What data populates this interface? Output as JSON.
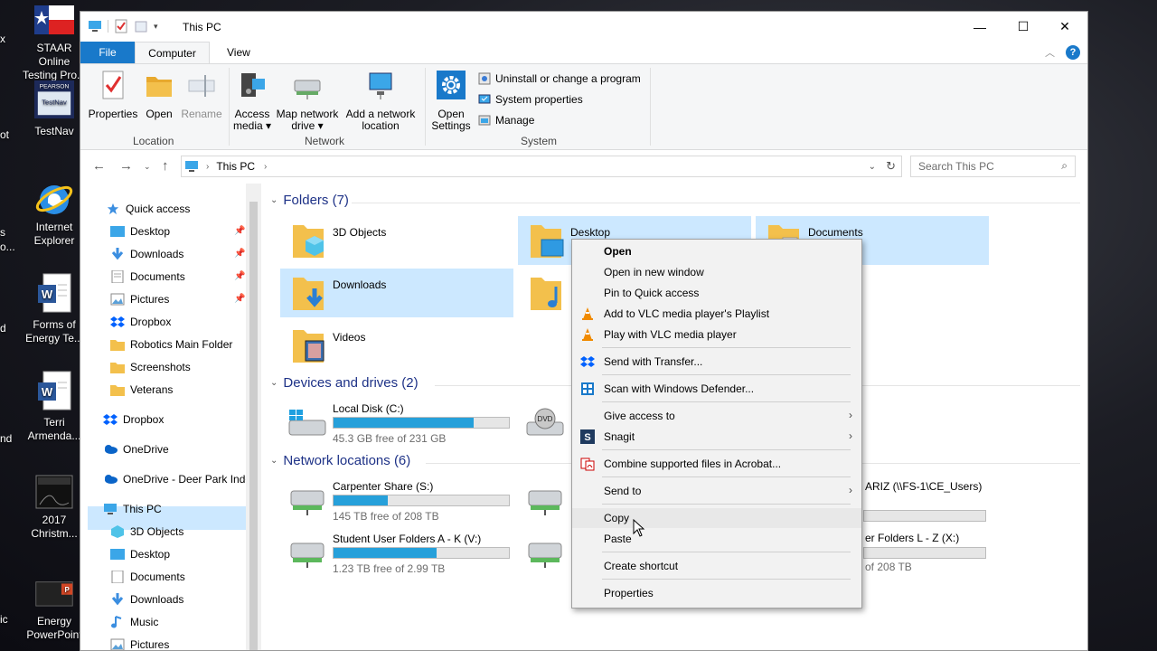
{
  "desktop": {
    "icons": [
      {
        "label": "STAAR Online Testing Pro...",
        "name": "staar-online-icon"
      },
      {
        "label": "TestNav",
        "name": "testnav-icon"
      },
      {
        "label": "Internet Explorer",
        "name": "internet-explorer-icon"
      },
      {
        "label": "Forms of Energy Te...",
        "name": "word-doc-icon"
      },
      {
        "label": "Terri Armenda...",
        "name": "word-doc-icon"
      },
      {
        "label": "2017 Christm...",
        "name": "video-thumbnail-icon"
      },
      {
        "label": "Energy PowerPoint",
        "name": "powerpoint-icon"
      }
    ],
    "edge_labels": [
      "x",
      "ot",
      "s",
      "o...",
      "d",
      "nd",
      "ic"
    ],
    "testnav_badge": "PEARSON",
    "testnav_badge_label": "TestNav"
  },
  "window": {
    "title": "This PC",
    "controls": {
      "minimize": "—",
      "maximize": "☐",
      "close": "✕"
    }
  },
  "ribbon": {
    "tabs": {
      "file": "File",
      "computer": "Computer",
      "view": "View"
    },
    "location": {
      "label": "Location",
      "properties": "Properties",
      "open": "Open",
      "rename": "Rename"
    },
    "network": {
      "label": "Network",
      "access_media_l1": "Access",
      "access_media_l2": "media ▾",
      "map_drive_l1": "Map network",
      "map_drive_l2": "drive ▾",
      "add_location_l1": "Add a network",
      "add_location_l2": "location"
    },
    "system": {
      "label": "System",
      "open_settings_l1": "Open",
      "open_settings_l2": "Settings",
      "uninstall": "Uninstall or change a program",
      "system_properties": "System properties",
      "manage": "Manage"
    }
  },
  "address": {
    "path": "This PC",
    "search_placeholder": "Search This PC"
  },
  "nav": {
    "quick_access": "Quick access",
    "items": [
      {
        "label": "Desktop",
        "pinned": true
      },
      {
        "label": "Downloads",
        "pinned": true
      },
      {
        "label": "Documents",
        "pinned": true
      },
      {
        "label": "Pictures",
        "pinned": true
      },
      {
        "label": "Dropbox"
      },
      {
        "label": "Robotics Main Folder"
      },
      {
        "label": "Screenshots"
      },
      {
        "label": "Veterans"
      }
    ],
    "dropbox": "Dropbox",
    "onedrive": "OneDrive",
    "onedrive_org": "OneDrive - Deer Park Inde",
    "this_pc": "This PC",
    "pc_items": [
      "3D Objects",
      "Desktop",
      "Documents",
      "Downloads",
      "Music",
      "Pictures"
    ]
  },
  "content": {
    "folders_header": "Folders (7)",
    "folders": [
      "3D Objects",
      "Desktop",
      "Documents",
      "Downloads",
      "Videos"
    ],
    "devices_header": "Devices and drives (2)",
    "local_disk": {
      "name": "Local Disk (C:)",
      "free": "45.3 GB free of 231 GB",
      "used_fraction": 0.8
    },
    "network_header": "Network locations (6)",
    "network_drives": [
      {
        "name": "Carpenter Share (S:)",
        "free": "145 TB free of 208 TB",
        "used_fraction": 0.31
      },
      {
        "name": "Student User Folders A - K (V:)",
        "free": "1.23 TB free of 2.99 TB",
        "used_fraction": 0.59
      }
    ],
    "partial_drive_1": "ARIZ (\\\\FS-1\\CE_Users)",
    "partial_drive_2": "er Folders L - Z (X:)",
    "partial_drive_2_free": "of 208 TB"
  },
  "context_menu": {
    "items": {
      "open": "Open",
      "open_new_window": "Open in new window",
      "pin_quick_access": "Pin to Quick access",
      "vlc_playlist": "Add to VLC media player's Playlist",
      "vlc_play": "Play with VLC media player",
      "send_transfer": "Send with Transfer...",
      "scan_defender": "Scan with Windows Defender...",
      "give_access": "Give access to",
      "snagit": "Snagit",
      "acrobat": "Combine supported files in Acrobat...",
      "send_to": "Send to",
      "copy": "Copy",
      "paste": "Paste",
      "create_shortcut": "Create shortcut",
      "properties": "Properties"
    }
  },
  "colors": {
    "accent": "#1979ca",
    "selection": "#cce8ff",
    "folder": "#f3c04c",
    "drive_fill": "#26a0da",
    "header_text": "#1e3287"
  }
}
